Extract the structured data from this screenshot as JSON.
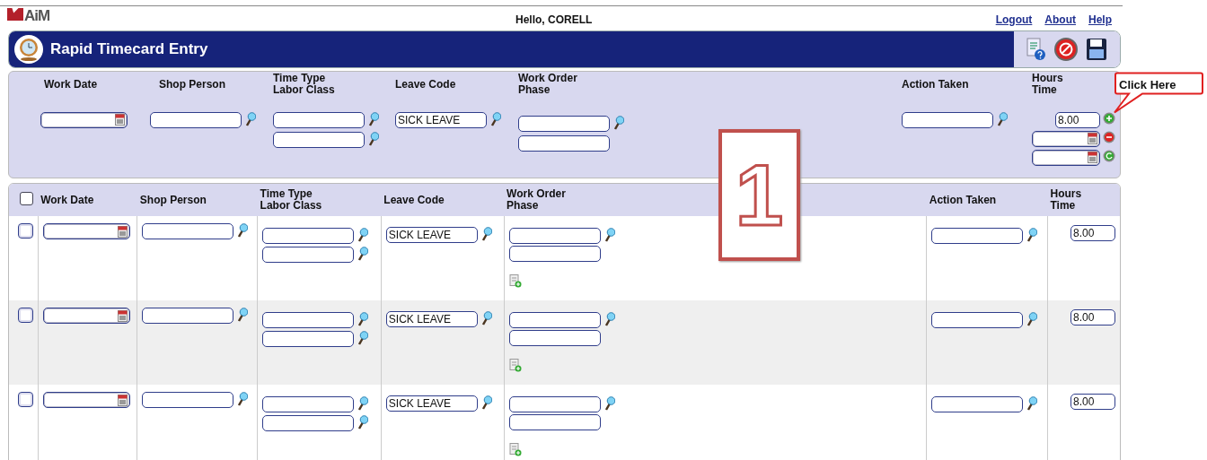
{
  "top_bar": {
    "logo": "AiM",
    "greeting": "Hello, CORELL",
    "links": [
      "Logout",
      "About",
      "Help"
    ]
  },
  "title": "Rapid Timecard Entry",
  "entry": {
    "columns": [
      "Work Date",
      "Shop Person",
      "Time Type\nLabor Class",
      "Leave Code",
      "Work Order\nPhase",
      "Action Taken",
      "Hours\nTime"
    ],
    "leave_code": "SICK LEAVE",
    "hours": "8.00"
  },
  "table": {
    "select_all": {
      "checked": false
    },
    "columns": [
      "Work Date",
      "Shop Person",
      "Time Type\nLabor Class",
      "Leave Code",
      "Work Order\nPhase",
      "Action Taken",
      "Hours\nTime"
    ],
    "rows": [
      {
        "checked": false,
        "leave_code": "SICK LEAVE",
        "hours": "8.00"
      },
      {
        "checked": false,
        "leave_code": "SICK LEAVE",
        "hours": "8.00"
      },
      {
        "checked": false,
        "leave_code": "SICK LEAVE",
        "hours": "8.00"
      }
    ]
  },
  "annotations": {
    "callout": "Click Here",
    "step_number": "1"
  }
}
